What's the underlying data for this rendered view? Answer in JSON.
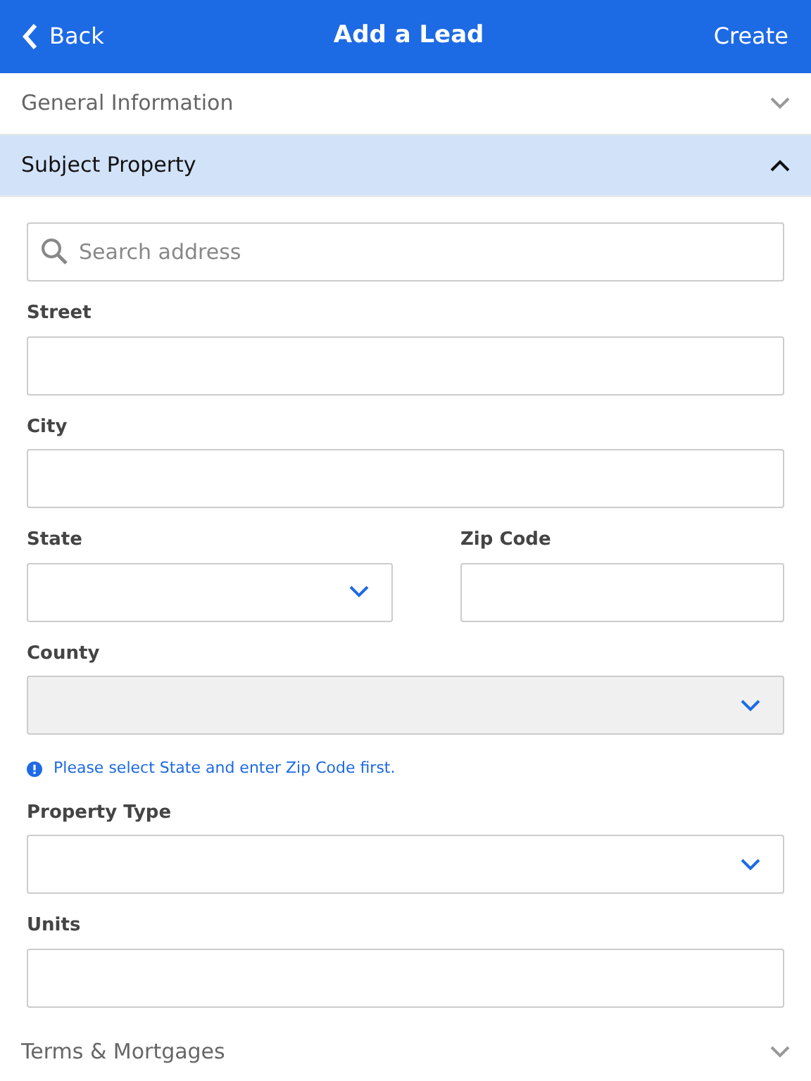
{
  "header": {
    "back": "Back",
    "title": "Add a Lead",
    "action": "Create"
  },
  "sections": [
    {
      "title": "General Information",
      "expanded": false
    },
    {
      "title": "Subject Property",
      "expanded": true,
      "rows": [
        [
          {
            "kind": "search",
            "placeholder": "Search address"
          }
        ],
        [
          {
            "kind": "text",
            "label": "Street",
            "disabled": false
          }
        ],
        [
          {
            "kind": "text",
            "label": "City",
            "disabled": false
          }
        ],
        [
          {
            "kind": "select",
            "label": "State",
            "disabled": false
          },
          {
            "kind": "text",
            "label": "Zip Code",
            "disabled": false
          }
        ],
        [
          {
            "kind": "select",
            "label": "County",
            "disabled": true,
            "notice": "Please select State and enter Zip Code first."
          }
        ],
        [
          {
            "kind": "select",
            "label": "Property Type",
            "disabled": false
          }
        ],
        [
          {
            "kind": "text",
            "label": "Units",
            "disabled": false
          }
        ]
      ]
    },
    {
      "title": "Terms & Mortgages",
      "expanded": false
    }
  ]
}
